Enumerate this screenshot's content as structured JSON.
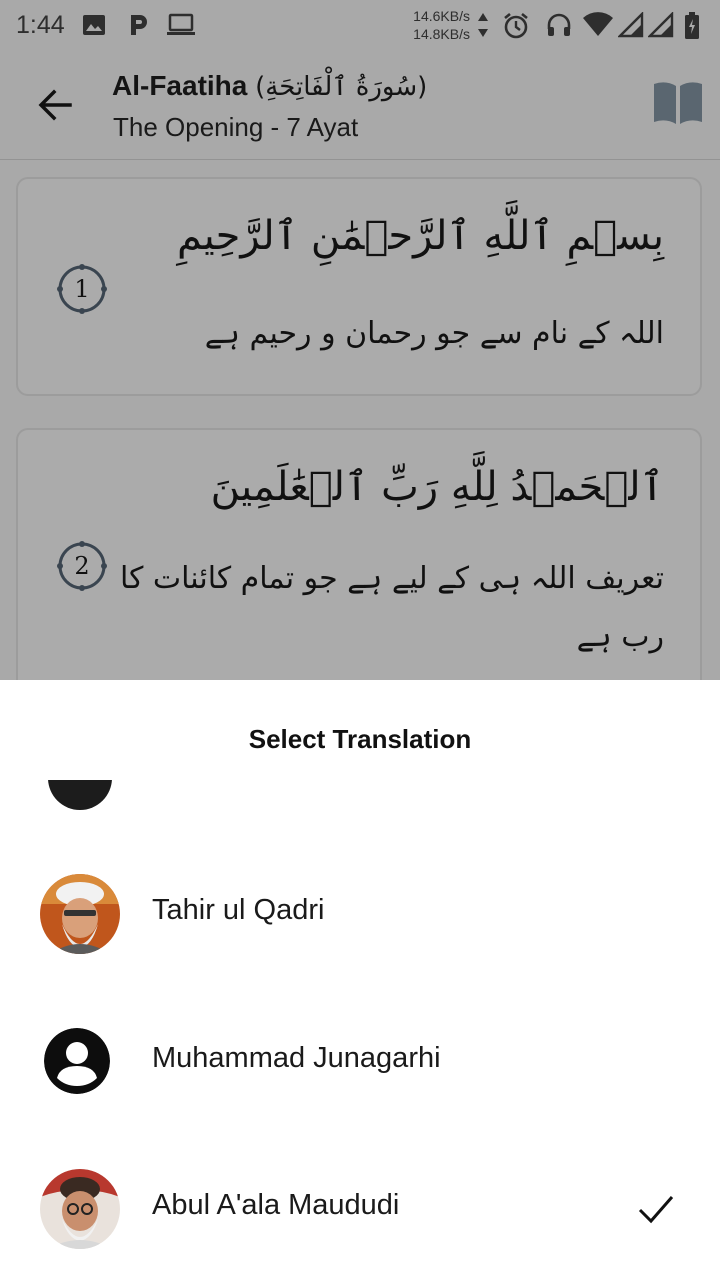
{
  "status_bar": {
    "time": "1:44",
    "speed_up": "14.6KB/s",
    "speed_down": "14.8KB/s",
    "left_icons": [
      "image-icon",
      "p-app-icon",
      "laptop-icon"
    ],
    "right_icons": [
      "data-arrows-icon",
      "alarm-icon",
      "headphones-icon",
      "wifi-icon",
      "signal-icon",
      "signal-icon",
      "battery-icon"
    ]
  },
  "header": {
    "title": "Al-Faatiha",
    "title_arabic": "(سُورَةُ ٱلْفَاتِحَةِ)",
    "subtitle": "The Opening - 7 Ayat",
    "back_icon": "arrow-back-icon",
    "book_icon": "open-book-icon"
  },
  "ayahs": [
    {
      "number": "1",
      "arabic": "بِسۡمِ ٱللَّهِ ٱلرَّحۡمَٰنِ ٱلرَّحِيمِ",
      "translation": "اللہ کے نام سے جو رحمان و رحیم ہے"
    },
    {
      "number": "2",
      "arabic": "ٱلۡحَمۡدُ لِلَّهِ رَبِّ ٱلۡعَٰلَمِينَ",
      "translation": "تعریف اللہ ہی کے لیے ہے جو تمام کائنات کا رب ہے"
    }
  ],
  "sheet": {
    "title": "Select Translation",
    "translators": [
      {
        "name": "Tahir ul Qadri",
        "avatar": "photo",
        "selected": false
      },
      {
        "name": "Muhammad Junagarhi",
        "avatar": "account-circle-icon",
        "selected": false
      },
      {
        "name": "Abul A'ala Maududi",
        "avatar": "photo",
        "selected": true
      }
    ],
    "check_icon": "checkmark-icon"
  },
  "colors": {
    "scrim": "#a9a9a9",
    "sheet_bg": "#ffffff",
    "text_primary": "#111111"
  }
}
